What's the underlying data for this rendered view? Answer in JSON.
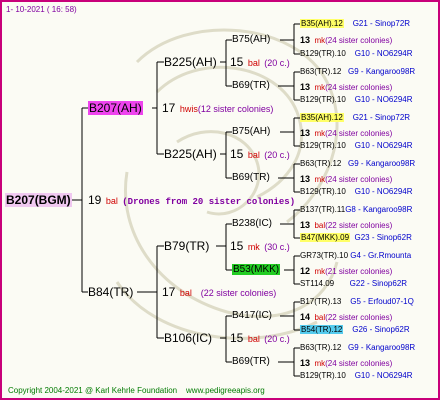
{
  "header": {
    "date": "1- 10-2021 ( 16: 58)"
  },
  "footer": {
    "copyright": "Copyright 2004-2021 @ Karl Kehrle Foundation",
    "url": "www.pedigreeapis.org"
  },
  "root": {
    "name": "B207(BGM)",
    "num": "19",
    "unit": "bal",
    "note": "(Drones from 20 sister colonies)"
  },
  "gen1": [
    {
      "name": "B207(AH)",
      "num": "17",
      "unit": "hwis",
      "note": "(12 sister colonies)"
    },
    {
      "name": "B84(TR)",
      "num": "17",
      "unit": "bal",
      "note": "(22 sister colonies)"
    }
  ],
  "gen2": [
    {
      "name": "B225(AH)",
      "num": "15",
      "unit": "bal",
      "note": "(20 c.)"
    },
    {
      "name": "B225(AH)",
      "num": "15",
      "unit": "bal",
      "note": "(20 c.)"
    },
    {
      "name": "B79(TR)",
      "num": "15",
      "unit": "mk",
      "note": "(30 c.)"
    },
    {
      "name": "B106(IC)",
      "num": "15",
      "unit": "bal",
      "note": "(20 c.)"
    }
  ],
  "gen3": [
    "B75(AH)",
    "B69(TR)",
    "B75(AH)",
    "B69(TR)",
    "B238(IC)",
    "B53(MKK)",
    "B417(IC)",
    "B69(TR)"
  ],
  "gen4": [
    {
      "top": "B35(AH).12",
      "toploc": "G21 - Sinop72R",
      "num": "13",
      "unit": "mk",
      "note": "(24 sister colonies)",
      "bot": "B129(TR).10",
      "botloc": "G10 - NO6294R"
    },
    {
      "top": "B63(TR).12",
      "toploc": "G9 - Kangaroo98R",
      "num": "13",
      "unit": "mk",
      "note": "(24 sister colonies)",
      "bot": "B129(TR).10",
      "botloc": "G10 - NO6294R"
    },
    {
      "top": "B35(AH).12",
      "toploc": "G21 - Sinop72R",
      "num": "13",
      "unit": "mk",
      "note": "(24 sister colonies)",
      "bot": "B129(TR).10",
      "botloc": "G10 - NO6294R"
    },
    {
      "top": "B63(TR).12",
      "toploc": "G9 - Kangaroo98R",
      "num": "13",
      "unit": "mk",
      "note": "(24 sister colonies)",
      "bot": "B129(TR).10",
      "botloc": "G10 - NO6294R"
    },
    {
      "top": "B137(TR).11",
      "toploc": "G8 - Kangaroo98R",
      "num": "13",
      "unit": "bal",
      "note": "(22 sister colonies)",
      "bot": "B47(MKK).09",
      "botloc": "G23 - Sinop62R"
    },
    {
      "top": "GR73(TR).10",
      "toploc": "G4 - Gr.Rmounta",
      "num": "12",
      "unit": "mk",
      "note": "(21 sister colonies)",
      "bot": "ST114.09",
      "botloc": "G22 - Sinop62R"
    },
    {
      "top": "B17(TR).13",
      "toploc": "G5 - Erfoud07-1Q",
      "num": "14",
      "unit": "bal",
      "note": "(22 sister colonies)",
      "bot": "B54(TR).12",
      "botloc": "G26 - Sinop62R"
    },
    {
      "top": "B63(TR).12",
      "toploc": "G9 - Kangaroo98R",
      "num": "13",
      "unit": "mk",
      "note": "(24 sister colonies)",
      "bot": "B129(TR).10",
      "botloc": "G10 - NO6294R"
    }
  ]
}
